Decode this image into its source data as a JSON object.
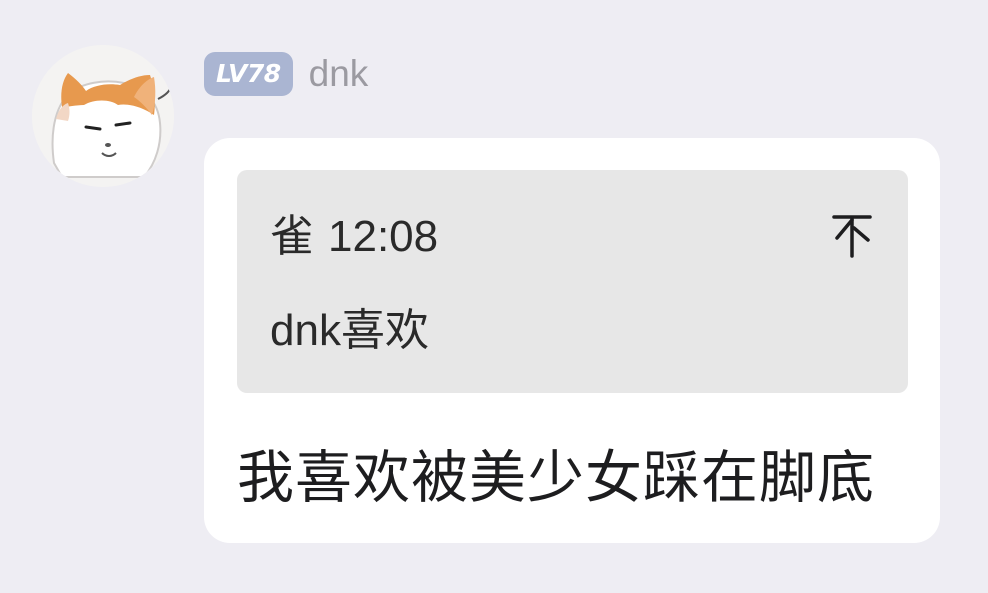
{
  "user": {
    "level_badge": "LV78",
    "name": "dnk",
    "avatar_icon": "cat-avatar-icon"
  },
  "quote": {
    "icon_char": "雀",
    "time": "12:08",
    "pin_icon": "pin-to-top-icon",
    "text": "dnk喜欢"
  },
  "message": {
    "text": "我喜欢被美少女踩在脚底"
  },
  "colors": {
    "background": "#eeedf3",
    "bubble": "#ffffff",
    "quote_card": "#e7e7e7",
    "level_badge": "#aab5d2",
    "username": "#9b9aa1"
  }
}
